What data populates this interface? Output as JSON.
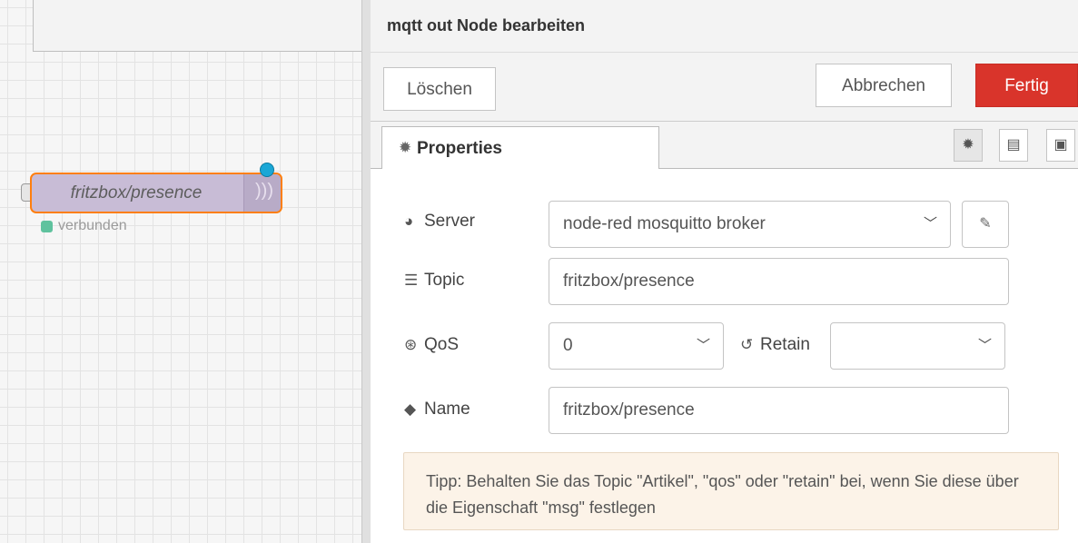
{
  "workspace": {
    "node": {
      "label": "fritzbox/presence",
      "status": "verbunden",
      "status_color": "#5fc29e",
      "border_color": "#ff7f0e",
      "fill_color": "#c8bcd6",
      "icon": "broadcast-icon"
    }
  },
  "tray": {
    "title": "mqtt out Node bearbeiten",
    "buttons": {
      "delete": "Löschen",
      "cancel": "Abbrechen",
      "done": "Fertig",
      "done_color": "#d9342b"
    },
    "tab": {
      "label": "Properties",
      "icon": "gear-icon"
    },
    "tab_icons": [
      "gear-icon",
      "document-icon",
      "frame-icon"
    ],
    "form": {
      "server": {
        "label": "Server",
        "value": "node-red mosquitto broker",
        "icon": "globe-icon"
      },
      "topic": {
        "label": "Topic",
        "value": "fritzbox/presence",
        "icon": "tasks-icon"
      },
      "qos": {
        "label": "QoS",
        "value": "0",
        "icon": "asterisk-icon"
      },
      "retain": {
        "label": "Retain",
        "value": "",
        "icon": "history-icon"
      },
      "name": {
        "label": "Name",
        "value": "fritzbox/presence",
        "icon": "tag-icon"
      }
    },
    "tip": "Tipp: Behalten Sie das Topic \"Artikel\", \"qos\" oder \"retain\" bei, wenn Sie diese über die Eigenschaft \"msg\" festlegen"
  }
}
